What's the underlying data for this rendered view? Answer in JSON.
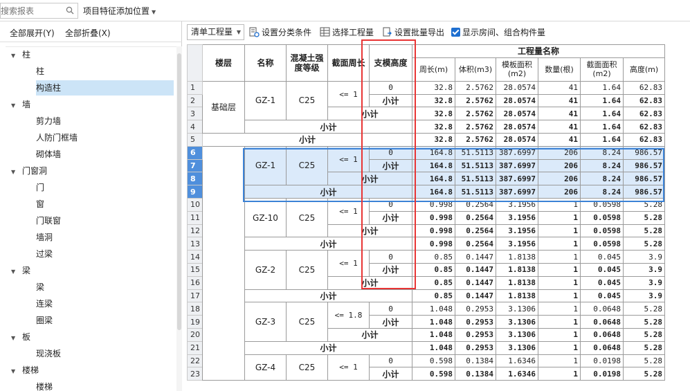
{
  "topbar": {
    "search_placeholder": "搜索报表",
    "feature_position_label": "项目特征添加位置"
  },
  "left_toolbar": {
    "expand_all": "全部展开(Y)",
    "collapse_all": "全部折叠(X)"
  },
  "tree": {
    "items": [
      {
        "type": "group",
        "label": "柱"
      },
      {
        "type": "child",
        "label": "柱"
      },
      {
        "type": "child",
        "label": "构造柱",
        "selected": true
      },
      {
        "type": "group",
        "label": "墙"
      },
      {
        "type": "child",
        "label": "剪力墙"
      },
      {
        "type": "child",
        "label": "人防门框墙"
      },
      {
        "type": "child",
        "label": "砌体墙"
      },
      {
        "type": "group",
        "label": "门窗洞"
      },
      {
        "type": "child",
        "label": "门"
      },
      {
        "type": "child",
        "label": "窗"
      },
      {
        "type": "child",
        "label": "门联窗"
      },
      {
        "type": "child",
        "label": "墙洞"
      },
      {
        "type": "child",
        "label": "过梁"
      },
      {
        "type": "group",
        "label": "梁"
      },
      {
        "type": "child",
        "label": "梁"
      },
      {
        "type": "child",
        "label": "连梁"
      },
      {
        "type": "child",
        "label": "圈梁"
      },
      {
        "type": "group",
        "label": "板"
      },
      {
        "type": "child",
        "label": "现浇板"
      },
      {
        "type": "group",
        "label": "楼梯"
      },
      {
        "type": "child",
        "label": "楼梯"
      }
    ]
  },
  "toolbar": {
    "qty_select_value": "清单工程量",
    "set_category": "设置分类条件",
    "select_quantity": "选择工程量",
    "batch_export": "设置批量导出",
    "show_room": "显示房间、组合构件量"
  },
  "grid": {
    "headers": {
      "floor": "楼层",
      "name": "名称",
      "concrete": "混凝土强度等级",
      "perimeter_section": "截面周长",
      "formwork_height": "支模高度",
      "quantity_name": "工程量名称",
      "perimeter": "周长(m)",
      "volume": "体积(m3)",
      "formwork_area": "模板面积(m2)",
      "count": "数量(根)",
      "section_area": "截面面积(m2)",
      "height": "高度(m)"
    },
    "subtotal_label": "小计",
    "floor_name": "基础层",
    "grade": "C25",
    "rows": [
      {
        "n": "1",
        "v": [
          "32.8",
          "2.5762",
          "28.0574",
          "41",
          "1.64",
          "62.83"
        ]
      },
      {
        "n": "2",
        "v": [
          "32.8",
          "2.5762",
          "28.0574",
          "41",
          "1.64",
          "62.83"
        ]
      },
      {
        "n": "3",
        "v": [
          "32.8",
          "2.5762",
          "28.0574",
          "41",
          "1.64",
          "62.83"
        ]
      },
      {
        "n": "4",
        "v": [
          "32.8",
          "2.5762",
          "28.0574",
          "41",
          "1.64",
          "62.83"
        ]
      },
      {
        "n": "5",
        "v": [
          "32.8",
          "2.5762",
          "28.0574",
          "41",
          "1.64",
          "62.83"
        ]
      },
      {
        "n": "6",
        "v": [
          "164.8",
          "51.5113",
          "387.6997",
          "206",
          "8.24",
          "986.57"
        ]
      },
      {
        "n": "7",
        "v": [
          "164.8",
          "51.5113",
          "387.6997",
          "206",
          "8.24",
          "986.57"
        ]
      },
      {
        "n": "8",
        "v": [
          "164.8",
          "51.5113",
          "387.6997",
          "206",
          "8.24",
          "986.57"
        ]
      },
      {
        "n": "9",
        "v": [
          "164.8",
          "51.5113",
          "387.6997",
          "206",
          "8.24",
          "986.57"
        ]
      },
      {
        "n": "10",
        "v": [
          "0.998",
          "0.2564",
          "3.1956",
          "1",
          "0.0598",
          "5.28"
        ]
      },
      {
        "n": "11",
        "v": [
          "0.998",
          "0.2564",
          "3.1956",
          "1",
          "0.0598",
          "5.28"
        ]
      },
      {
        "n": "12",
        "v": [
          "0.998",
          "0.2564",
          "3.1956",
          "1",
          "0.0598",
          "5.28"
        ]
      },
      {
        "n": "13",
        "v": [
          "0.998",
          "0.2564",
          "3.1956",
          "1",
          "0.0598",
          "5.28"
        ]
      },
      {
        "n": "14",
        "v": [
          "0.85",
          "0.1447",
          "1.8138",
          "1",
          "0.045",
          "3.9"
        ]
      },
      {
        "n": "15",
        "v": [
          "0.85",
          "0.1447",
          "1.8138",
          "1",
          "0.045",
          "3.9"
        ]
      },
      {
        "n": "16",
        "v": [
          "0.85",
          "0.1447",
          "1.8138",
          "1",
          "0.045",
          "3.9"
        ]
      },
      {
        "n": "17",
        "v": [
          "0.85",
          "0.1447",
          "1.8138",
          "1",
          "0.045",
          "3.9"
        ]
      },
      {
        "n": "18",
        "v": [
          "1.048",
          "0.2953",
          "3.1306",
          "1",
          "0.0648",
          "5.28"
        ]
      },
      {
        "n": "19",
        "v": [
          "1.048",
          "0.2953",
          "3.1306",
          "1",
          "0.0648",
          "5.28"
        ]
      },
      {
        "n": "20",
        "v": [
          "1.048",
          "0.2953",
          "3.1306",
          "1",
          "0.0648",
          "5.28"
        ]
      },
      {
        "n": "21",
        "v": [
          "1.048",
          "0.2953",
          "3.1306",
          "1",
          "0.0648",
          "5.28"
        ]
      },
      {
        "n": "22",
        "v": [
          "0.598",
          "0.1384",
          "1.6346",
          "1",
          "0.0198",
          "5.28"
        ]
      },
      {
        "n": "23",
        "v": [
          "0.598",
          "0.1384",
          "1.6346",
          "1",
          "0.0198",
          "5.28"
        ]
      }
    ],
    "groups": [
      {
        "name": "GZ-1",
        "perimeter": "<= 1",
        "height": "0"
      },
      {
        "name": "GZ-1",
        "perimeter": "<= 1",
        "height": "0"
      },
      {
        "name": "GZ-10",
        "perimeter": "<= 1",
        "height": "0"
      },
      {
        "name": "GZ-2",
        "perimeter": "<= 1",
        "height": "0"
      },
      {
        "name": "GZ-3",
        "perimeter": "<= 1.8",
        "height": "0"
      },
      {
        "name": "GZ-4",
        "perimeter": "<= 1",
        "height": "0"
      }
    ]
  },
  "colors": {
    "selection_blue": "#3b82d6",
    "highlight_red": "#e83434",
    "selected_row_bg": "#dbeafa"
  }
}
